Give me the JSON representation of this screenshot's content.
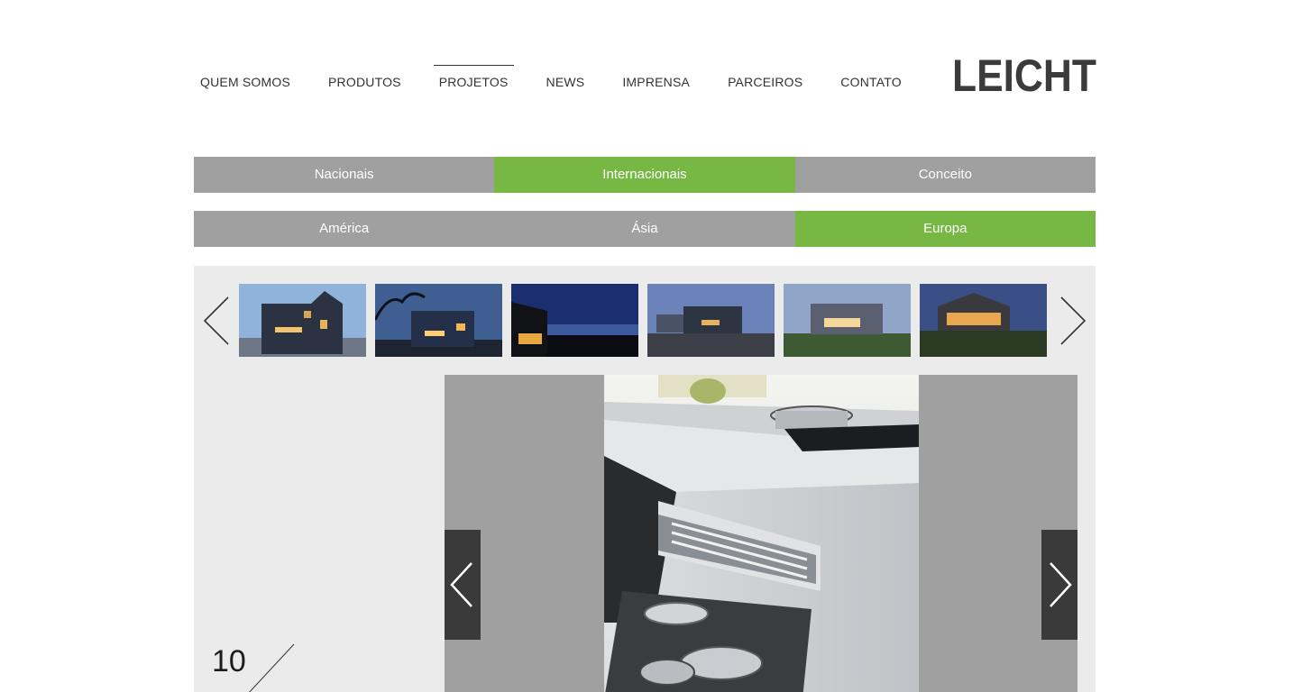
{
  "nav": {
    "items": [
      {
        "label": "QUEM SOMOS"
      },
      {
        "label": "PRODUTOS"
      },
      {
        "label": "PROJETOS"
      },
      {
        "label": "NEWS"
      },
      {
        "label": "IMPRENSA"
      },
      {
        "label": "PARCEIROS"
      },
      {
        "label": "CONTATO"
      }
    ],
    "active": "PROJETOS"
  },
  "logo": {
    "text": "LEICHT",
    "color": "#3b3b3b"
  },
  "category_tabs": [
    {
      "label": "Nacionais"
    },
    {
      "label": "Internacionais"
    },
    {
      "label": "Conceito"
    }
  ],
  "region_tabs": [
    {
      "label": "América"
    },
    {
      "label": "Ásia"
    },
    {
      "label": "Europa"
    }
  ],
  "active_category": "Internacionais",
  "active_region": "Europa",
  "gallery": {
    "counter": "10",
    "thumbnail_count": 6
  },
  "colors": {
    "accent": "#76b843",
    "tab_gray": "#a0a0a0",
    "panel_bg": "#ebebeb",
    "dark_arrow": "#3a3a3a"
  },
  "icons": {
    "thumb_prev": "chevron-left-icon",
    "thumb_next": "chevron-right-icon",
    "image_prev": "chevron-left-icon",
    "image_next": "chevron-right-icon"
  }
}
